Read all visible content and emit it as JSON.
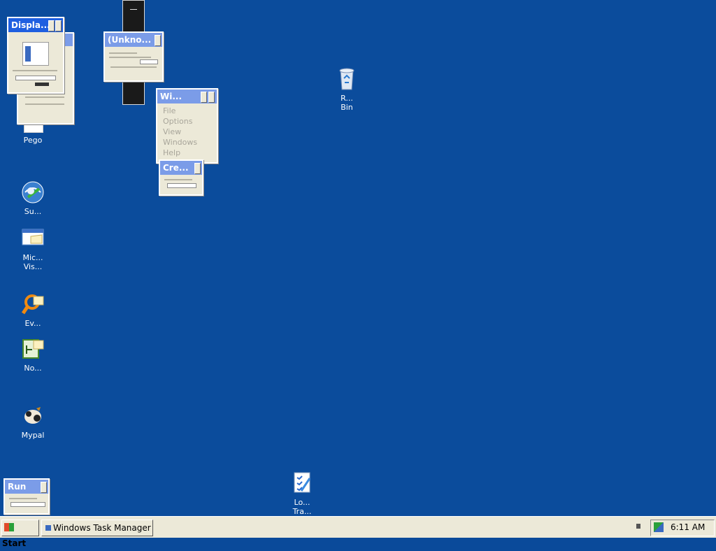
{
  "desktop": {
    "icons": [
      {
        "name": "Pego",
        "icon": "pego-icon"
      },
      {
        "name": "Su...",
        "icon": "support-globe-icon"
      },
      {
        "name": "Mic...\nVis...",
        "icon": "microsoft-visio-folder-icon"
      },
      {
        "name": "Ev...",
        "icon": "event-viewer-icon"
      },
      {
        "name": "No...",
        "icon": "notepad-folder-icon"
      },
      {
        "name": "Mypal",
        "icon": "mypal-icon"
      },
      {
        "name": "R...\nBin",
        "icon": "recycle-bin-icon"
      },
      {
        "name": "Lo...\nTra...",
        "icon": "log-tracker-icon"
      }
    ]
  },
  "windows": {
    "display": {
      "title": "Displa..."
    },
    "unknown": {
      "title": "(Unkno..."
    },
    "task_manager": {
      "title": "Wi...",
      "menu": [
        "File",
        "Options",
        "View",
        "Windows",
        "Help"
      ]
    },
    "create": {
      "title": "Cre..."
    },
    "run": {
      "title": "Run"
    }
  },
  "taskbar": {
    "start_label": "Start",
    "task_button_label": "Windows Task Manager",
    "clock": "6:11 AM"
  },
  "colors": {
    "desktop": "#0b4c9c",
    "title_active": "#1f5fe0",
    "title_inactive": "#7b9ce8",
    "window_face": "#ece9d8"
  }
}
